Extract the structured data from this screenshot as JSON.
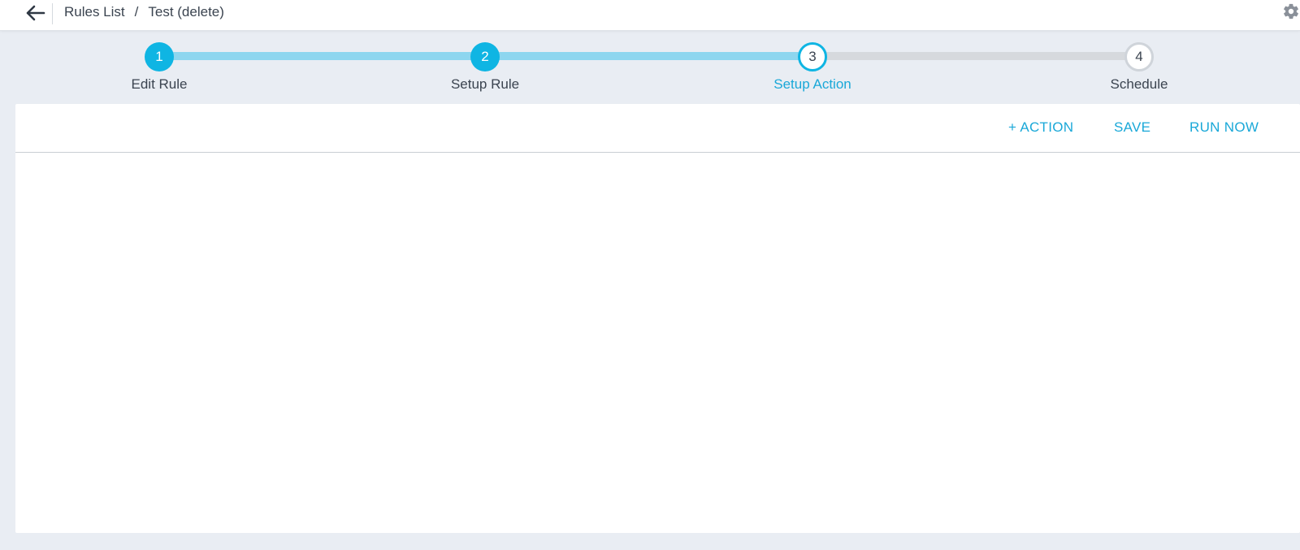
{
  "header": {
    "back_icon": "arrow-left-icon",
    "breadcrumb": {
      "parent": "Rules List",
      "separator": "/",
      "current": "Test (delete)"
    },
    "settings_icon": "gear-icon"
  },
  "stepper": {
    "steps": [
      {
        "number": "1",
        "label": "Edit Rule",
        "state": "done"
      },
      {
        "number": "2",
        "label": "Setup Rule",
        "state": "done"
      },
      {
        "number": "3",
        "label": "Setup Action",
        "state": "current"
      },
      {
        "number": "4",
        "label": "Schedule",
        "state": "todo"
      }
    ]
  },
  "toolbar": {
    "add_action_label": "+ ACTION",
    "save_label": "SAVE",
    "run_now_label": "RUN NOW"
  },
  "colors": {
    "accent": "#0fb5e3",
    "accent_text": "#1aa8d8",
    "track_done": "#8dd6ef",
    "track_todo": "#d6d9dd",
    "page_bg": "#e9edf3"
  }
}
